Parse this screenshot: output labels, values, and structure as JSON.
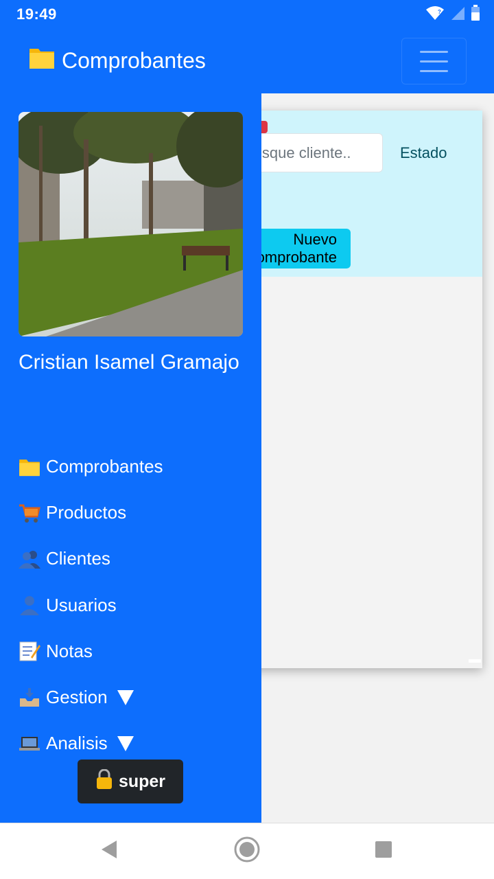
{
  "status_bar": {
    "time": "19:49"
  },
  "app": {
    "title": "Comprobantes",
    "title_icon": "folder-icon"
  },
  "card": {
    "search_placeholder": "Busque cliente..",
    "estado_label": "Estado",
    "new_button_label": "Nuevo Comprobante"
  },
  "drawer": {
    "user_name": "Cristian Isamel Gramajo",
    "menu": [
      {
        "label": "Comprobantes",
        "icon": "folder-icon"
      },
      {
        "label": "Productos",
        "icon": "cart-icon"
      },
      {
        "label": "Clientes",
        "icon": "users-icon"
      },
      {
        "label": "Usuarios",
        "icon": "user-icon"
      },
      {
        "label": "Notas",
        "icon": "memo-icon"
      },
      {
        "label": "Gestion",
        "icon": "inbox-icon",
        "dropdown": true
      },
      {
        "label": "Analisis",
        "icon": "laptop-icon",
        "dropdown": true
      }
    ],
    "super_label": "super"
  },
  "colors": {
    "primary": "#0d6efd",
    "info_light": "#cff4fc",
    "info": "#0dcaf0",
    "dark": "#212529",
    "danger": "#dc3545"
  }
}
